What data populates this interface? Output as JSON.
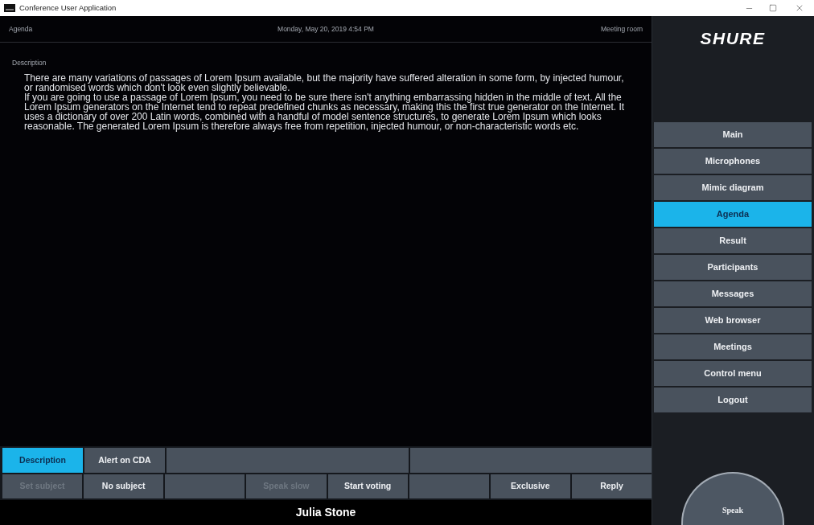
{
  "window": {
    "title": "Conference User Application"
  },
  "header": {
    "section": "Agenda",
    "datetime": "Monday, May 20, 2019 4:54 PM",
    "room": "Meeting room"
  },
  "content": {
    "label": "Description",
    "paragraphs": [
      "There are many variations of passages of Lorem Ipsum available, but the majority have suffered alteration in some form, by injected humour, or randomised words which don't look even slightly believable.",
      "If you are going to use a passage of Lorem Ipsum, you need to be sure there isn't anything embarrassing hidden in the middle of text. All the Lorem Ipsum generators on the Internet tend to repeat predefined chunks as necessary, making this the first true generator on the Internet. It uses a dictionary of over 200 Latin words, combined with a handful of model sentence structures, to generate Lorem Ipsum which looks reasonable. The generated Lorem Ipsum is therefore always free from repetition, injected humour, or non-characteristic words etc."
    ]
  },
  "tabs": [
    {
      "kind": "tab",
      "label": "Description",
      "selected": true
    },
    {
      "kind": "tab",
      "label": "Alert on CDA",
      "selected": false
    },
    {
      "kind": "blank"
    },
    {
      "kind": "blank"
    }
  ],
  "actions": [
    {
      "kind": "button",
      "label": "Set subject",
      "disabled": true
    },
    {
      "kind": "button",
      "label": "No subject",
      "disabled": false
    },
    {
      "kind": "blank"
    },
    {
      "kind": "button",
      "label": "Speak slow",
      "disabled": true
    },
    {
      "kind": "button",
      "label": "Start voting",
      "disabled": false
    },
    {
      "kind": "blank"
    },
    {
      "kind": "button",
      "label": "Exclusive",
      "disabled": false
    },
    {
      "kind": "button",
      "label": "Reply",
      "disabled": false
    }
  ],
  "speaker": "Julia Stone",
  "brand": {
    "logo": "SHURE"
  },
  "menu": [
    {
      "label": "Main",
      "selected": false
    },
    {
      "label": "Microphones",
      "selected": false
    },
    {
      "label": "Mimic diagram",
      "selected": false
    },
    {
      "label": "Agenda",
      "selected": true
    },
    {
      "label": "Result",
      "selected": false
    },
    {
      "label": "Participants",
      "selected": false
    },
    {
      "label": "Messages",
      "selected": false
    },
    {
      "label": "Web browser",
      "selected": false
    },
    {
      "label": "Meetings",
      "selected": false
    },
    {
      "label": "Control menu",
      "selected": false
    },
    {
      "label": "Logout",
      "selected": false
    }
  ],
  "speak_button": {
    "label": "Speak"
  }
}
